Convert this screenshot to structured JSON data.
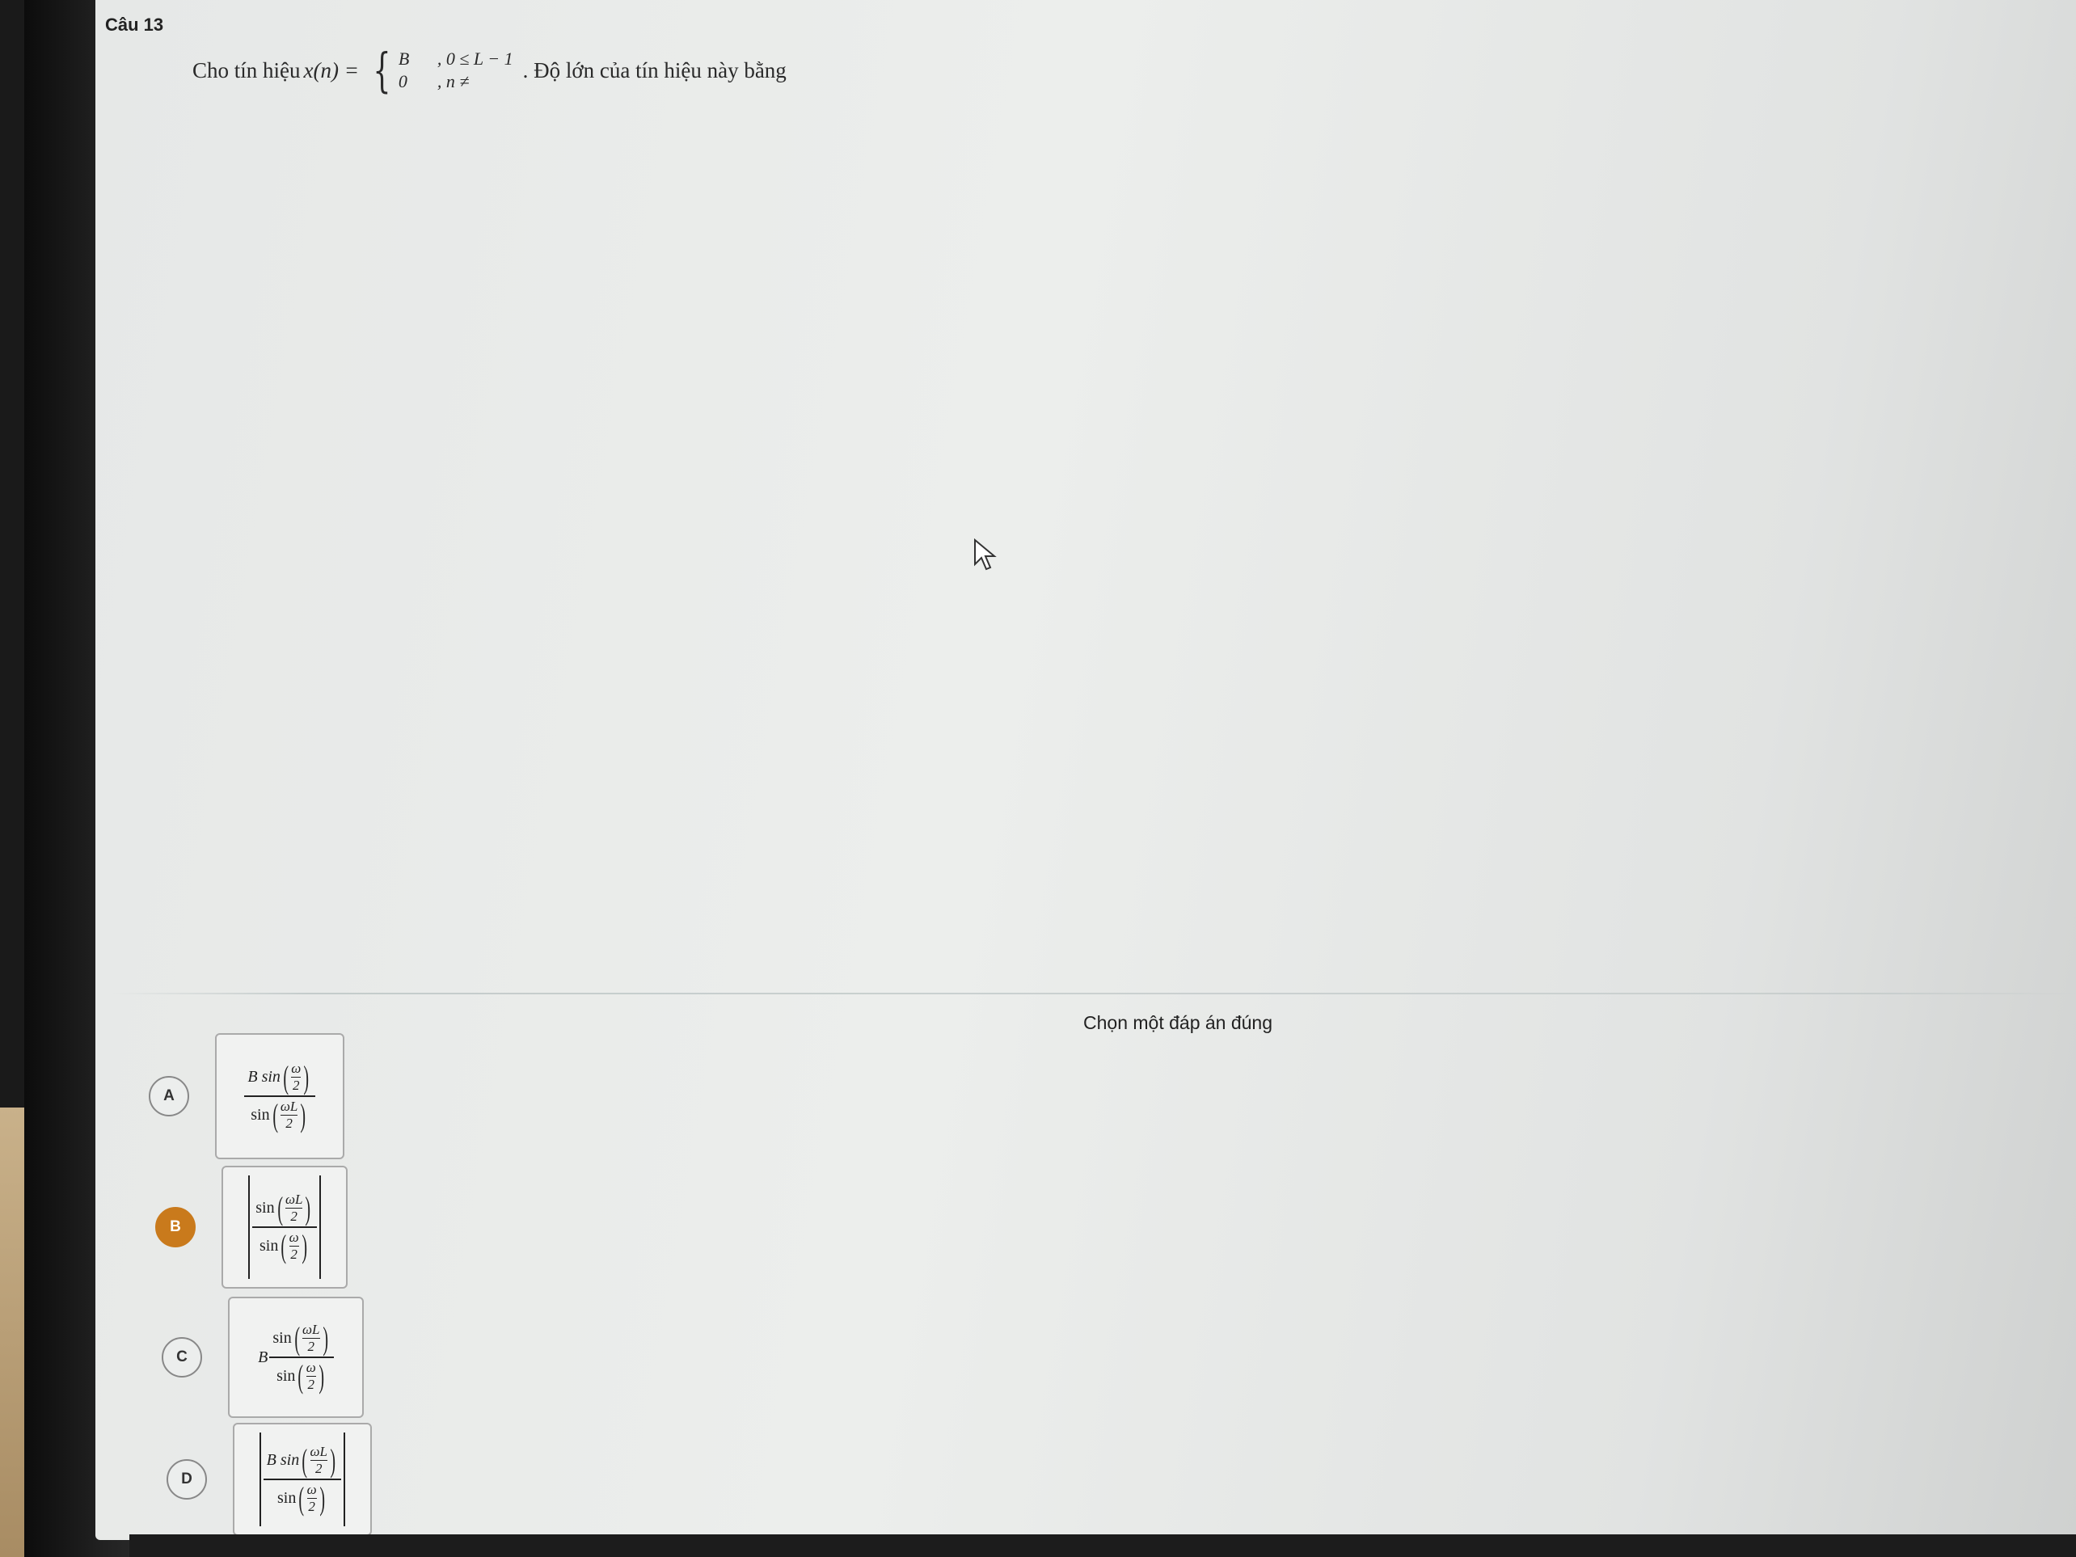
{
  "question": {
    "number": "Câu 13",
    "prefix": "Cho tín hiệu",
    "function": "x(n) =",
    "case1_value": "B",
    "case1_cond": ", 0 ≤ L − 1",
    "case2_value": "0",
    "case2_cond": ", n ≠",
    "suffix": ". Độ lớn của tín hiệu này bằng"
  },
  "prompt": "Chọn một đáp án đúng",
  "options": [
    {
      "letter": "A",
      "num_coef": "B sin",
      "num_arg": "ω",
      "num_arg_den": "2",
      "den_fn": "sin",
      "den_arg": "ωL",
      "den_arg_den": "2",
      "selected": false
    },
    {
      "letter": "B",
      "num_coef": "sin",
      "num_arg": "ωL",
      "num_arg_den": "2",
      "den_fn": "sin",
      "den_arg": "ω",
      "den_arg_den": "2",
      "selected": true
    },
    {
      "letter": "C",
      "prefix": "B",
      "num_coef": "sin",
      "num_arg": "ωL",
      "num_arg_den": "2",
      "den_fn": "sin",
      "den_arg": "ω",
      "den_arg_den": "2",
      "selected": false
    },
    {
      "letter": "D",
      "num_coef": "B sin",
      "num_arg": "ωL",
      "num_arg_den": "2",
      "den_fn": "sin",
      "den_arg": "ω",
      "den_arg_den": "2",
      "selected": false
    }
  ],
  "colors": {
    "selected": "#c97a1c",
    "screen": "#e8eae9"
  },
  "icons": {
    "cursor": "mouse-pointer-icon"
  }
}
